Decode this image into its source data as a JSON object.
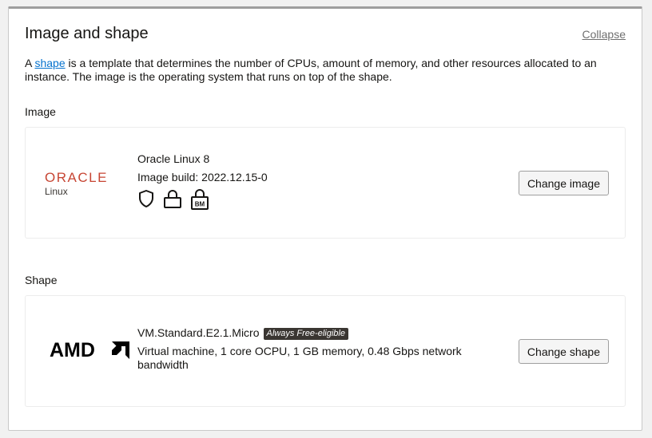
{
  "section": {
    "title": "Image and shape",
    "collapse_label": "Collapse",
    "description_prefix": "A ",
    "description_link": "shape",
    "description_rest": " is a template that determines the number of CPUs, amount of memory, and other resources allocated to an instance. The image is the operating system that runs on top of the shape."
  },
  "image": {
    "label": "Image",
    "logo_brand": "ORACLE",
    "logo_sub": "Linux",
    "name": "Oracle Linux 8",
    "build": "Image build: 2022.12.15-0",
    "icons": [
      "shield-icon",
      "lock-icon",
      "bm-lock-icon"
    ],
    "bm_text": "BM",
    "button_label": "Change image"
  },
  "shape": {
    "label": "Shape",
    "logo_brand": "AMD",
    "name": "VM.Standard.E2.1.Micro",
    "badge": "Always Free-eligible",
    "details": "Virtual machine, 1 core OCPU, 1 GB memory, 0.48 Gbps network bandwidth",
    "button_label": "Change shape"
  },
  "colors": {
    "oracle_red": "#c74634",
    "link_blue": "#0572ce",
    "badge_bg": "#3a3632"
  }
}
